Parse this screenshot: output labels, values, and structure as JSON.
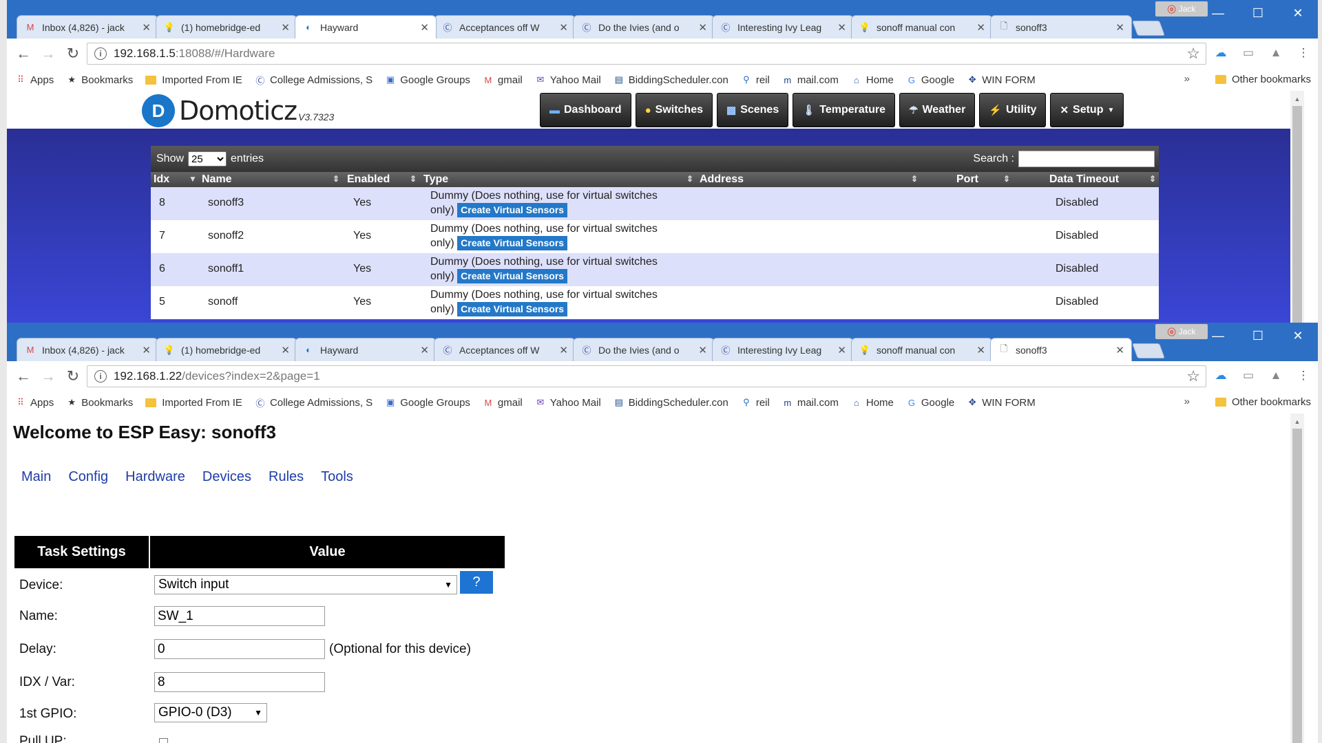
{
  "tabs": [
    {
      "label": "Inbox (4,826) - jack",
      "icon": "gmail-icon"
    },
    {
      "label": "(1) homebridge-ed",
      "icon": "bulb-icon"
    },
    {
      "label": "Hayward",
      "icon": "domoticz-icon"
    },
    {
      "label": "Acceptances off W",
      "icon": "c-icon"
    },
    {
      "label": "Do the Ivies (and o",
      "icon": "c-icon"
    },
    {
      "label": "Interesting Ivy Leag",
      "icon": "c-icon"
    },
    {
      "label": "sonoff manual con",
      "icon": "bulb-icon"
    },
    {
      "label": "sonoff3",
      "icon": "page-icon"
    }
  ],
  "profile_name": "Jack",
  "window1": {
    "url_host": "192.168.1.5",
    "url_path": ":18088/#/Hardware",
    "active_tab": 2
  },
  "window2": {
    "url_host": "192.168.1.22",
    "url_path": "/devices?index=2&page=1",
    "active_tab": 7
  },
  "bookmarks": [
    {
      "label": "Apps",
      "icon": "apps-icon"
    },
    {
      "label": "Bookmarks",
      "icon": "star-icon"
    },
    {
      "label": "Imported From IE",
      "icon": "folder-icon"
    },
    {
      "label": "College Admissions, S",
      "icon": "c-icon"
    },
    {
      "label": "Google Groups",
      "icon": "groups-icon"
    },
    {
      "label": "gmail",
      "icon": "gmail-icon"
    },
    {
      "label": "Yahoo Mail",
      "icon": "mail-icon"
    },
    {
      "label": "BiddingScheduler.con",
      "icon": "bid-icon"
    },
    {
      "label": "reil",
      "icon": "reil-icon"
    },
    {
      "label": "mail.com",
      "icon": "mailcom-icon"
    },
    {
      "label": "Home",
      "icon": "home-icon"
    },
    {
      "label": "Google",
      "icon": "google-icon"
    },
    {
      "label": "WIN FORM",
      "icon": "winform-icon"
    }
  ],
  "bookmarks_more": "»",
  "other_bookmarks": "Other bookmarks",
  "domoticz": {
    "logo_text": "Domoticz",
    "version": "V3.7323",
    "nav": [
      "Dashboard",
      "Switches",
      "Scenes",
      "Temperature",
      "Weather",
      "Utility",
      "Setup"
    ],
    "show_label": "Show",
    "show_value": "25",
    "entries_label": "entries",
    "search_label": "Search :",
    "columns": [
      "Idx",
      "Name",
      "Enabled",
      "Type",
      "Address",
      "Port",
      "Data Timeout"
    ],
    "rows": [
      {
        "idx": "8",
        "name": "sonoff3",
        "enabled": "Yes",
        "type_line1": "Dummy (Does nothing, use for virtual switches",
        "type_line2": "only)",
        "button": "Create Virtual Sensors",
        "timeout": "Disabled"
      },
      {
        "idx": "7",
        "name": "sonoff2",
        "enabled": "Yes",
        "type_line1": "Dummy (Does nothing, use for virtual switches",
        "type_line2": "only)",
        "button": "Create Virtual Sensors",
        "timeout": "Disabled"
      },
      {
        "idx": "6",
        "name": "sonoff1",
        "enabled": "Yes",
        "type_line1": "Dummy (Does nothing, use for virtual switches",
        "type_line2": "only)",
        "button": "Create Virtual Sensors",
        "timeout": "Disabled"
      },
      {
        "idx": "5",
        "name": "sonoff",
        "enabled": "Yes",
        "type_line1": "Dummy (Does nothing, use for virtual switches",
        "type_line2": "only)",
        "button": "Create Virtual Sensors",
        "timeout": "Disabled"
      }
    ]
  },
  "esp": {
    "title": "Welcome to ESP Easy: sonoff3",
    "menu": [
      "Main",
      "Config",
      "Hardware",
      "Devices",
      "Rules",
      "Tools"
    ],
    "th_settings": "Task Settings",
    "th_value": "Value",
    "device_label": "Device:",
    "device_value": "Switch input",
    "help_label": "?",
    "name_label": "Name:",
    "name_value": "SW_1",
    "delay_label": "Delay:",
    "delay_value": "0",
    "delay_note": "(Optional for this device)",
    "idx_label": "IDX / Var:",
    "idx_value": "8",
    "gpio_label": "1st GPIO:",
    "gpio_value": "GPIO-0 (D3)",
    "pullup_label": "Pull UP:"
  }
}
